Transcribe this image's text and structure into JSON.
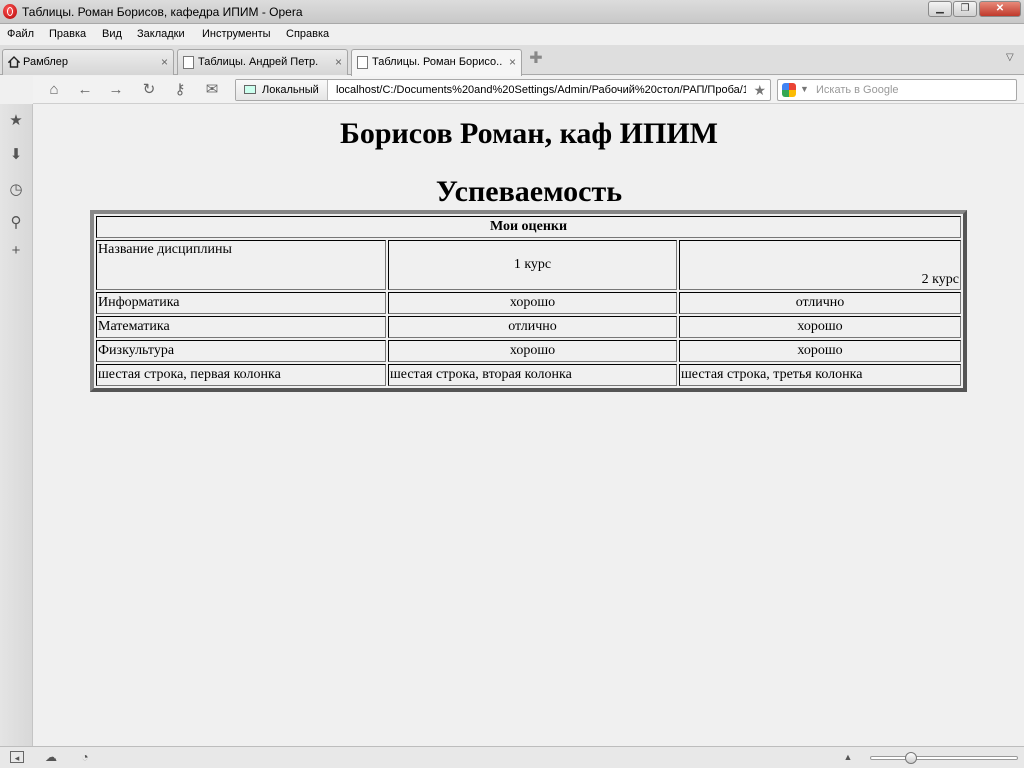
{
  "window": {
    "title": "Таблицы. Роман Борисов, кафедра ИПИМ - Opera"
  },
  "menu": [
    "Файл",
    "Правка",
    "Вид",
    "Закладки",
    "Инструменты",
    "Справка"
  ],
  "tabs": [
    {
      "label": "Рамблер",
      "close": "×",
      "icon": "home-icon"
    },
    {
      "label": "Таблицы. Андрей Петр...",
      "close": "×",
      "icon": "page-icon"
    },
    {
      "label": "Таблицы. Роман Борисо...",
      "close": "×",
      "icon": "page-icon",
      "active": true
    }
  ],
  "address": {
    "zone_label": "Локальный",
    "url": "localhost/C:/Documents%20and%20Settings/Admin/Рабочий%20стол/РАП/Проба/1"
  },
  "search": {
    "placeholder": "Искать в Google",
    "engine": "google-icon"
  },
  "page": {
    "heading": "Борисов Роман, каф ИПИМ",
    "subheading": "Успеваемость",
    "table": {
      "caption_header": "Мои оценки",
      "header_row": [
        "Название дисциплины",
        "1 курс",
        "2 курс"
      ],
      "rows": [
        [
          "Информатика",
          "хорошо",
          "отлично"
        ],
        [
          "Математика",
          "отлично",
          "хорошо"
        ],
        [
          "Физкультура",
          "хорошо",
          "хорошо"
        ],
        [
          "шестая строка, первая колонка",
          "шестая строка, вторая колонка",
          "шестая строка, третья колонка"
        ]
      ]
    }
  },
  "statusbar": {
    "zoom_fraction": 0.28
  }
}
